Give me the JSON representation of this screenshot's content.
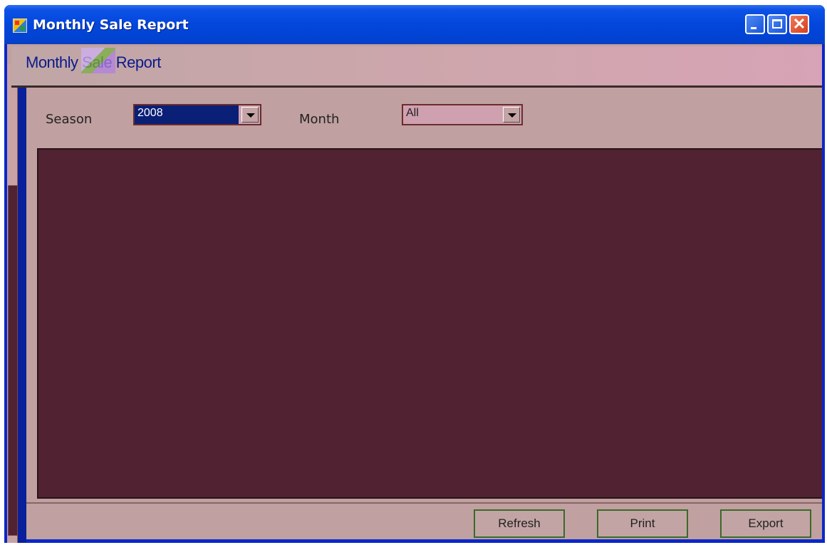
{
  "window": {
    "title": "Monthly Sale Report",
    "caption_buttons": {
      "minimize": "minimize",
      "maximize": "maximize",
      "close": "✕"
    }
  },
  "header": {
    "title": "Monthly Sale Report"
  },
  "filters": {
    "season_label": "Season",
    "season_value": "2008",
    "month_label": "Month",
    "month_value": "All"
  },
  "actions": {
    "refresh_label": "Refresh",
    "print_label": "Print",
    "export_label": "Export"
  },
  "colors": {
    "titlebar": "#0246dc",
    "panel_background": "#c0a0a0",
    "grid_background": "#502232",
    "header_text": "#0b1b8a"
  }
}
